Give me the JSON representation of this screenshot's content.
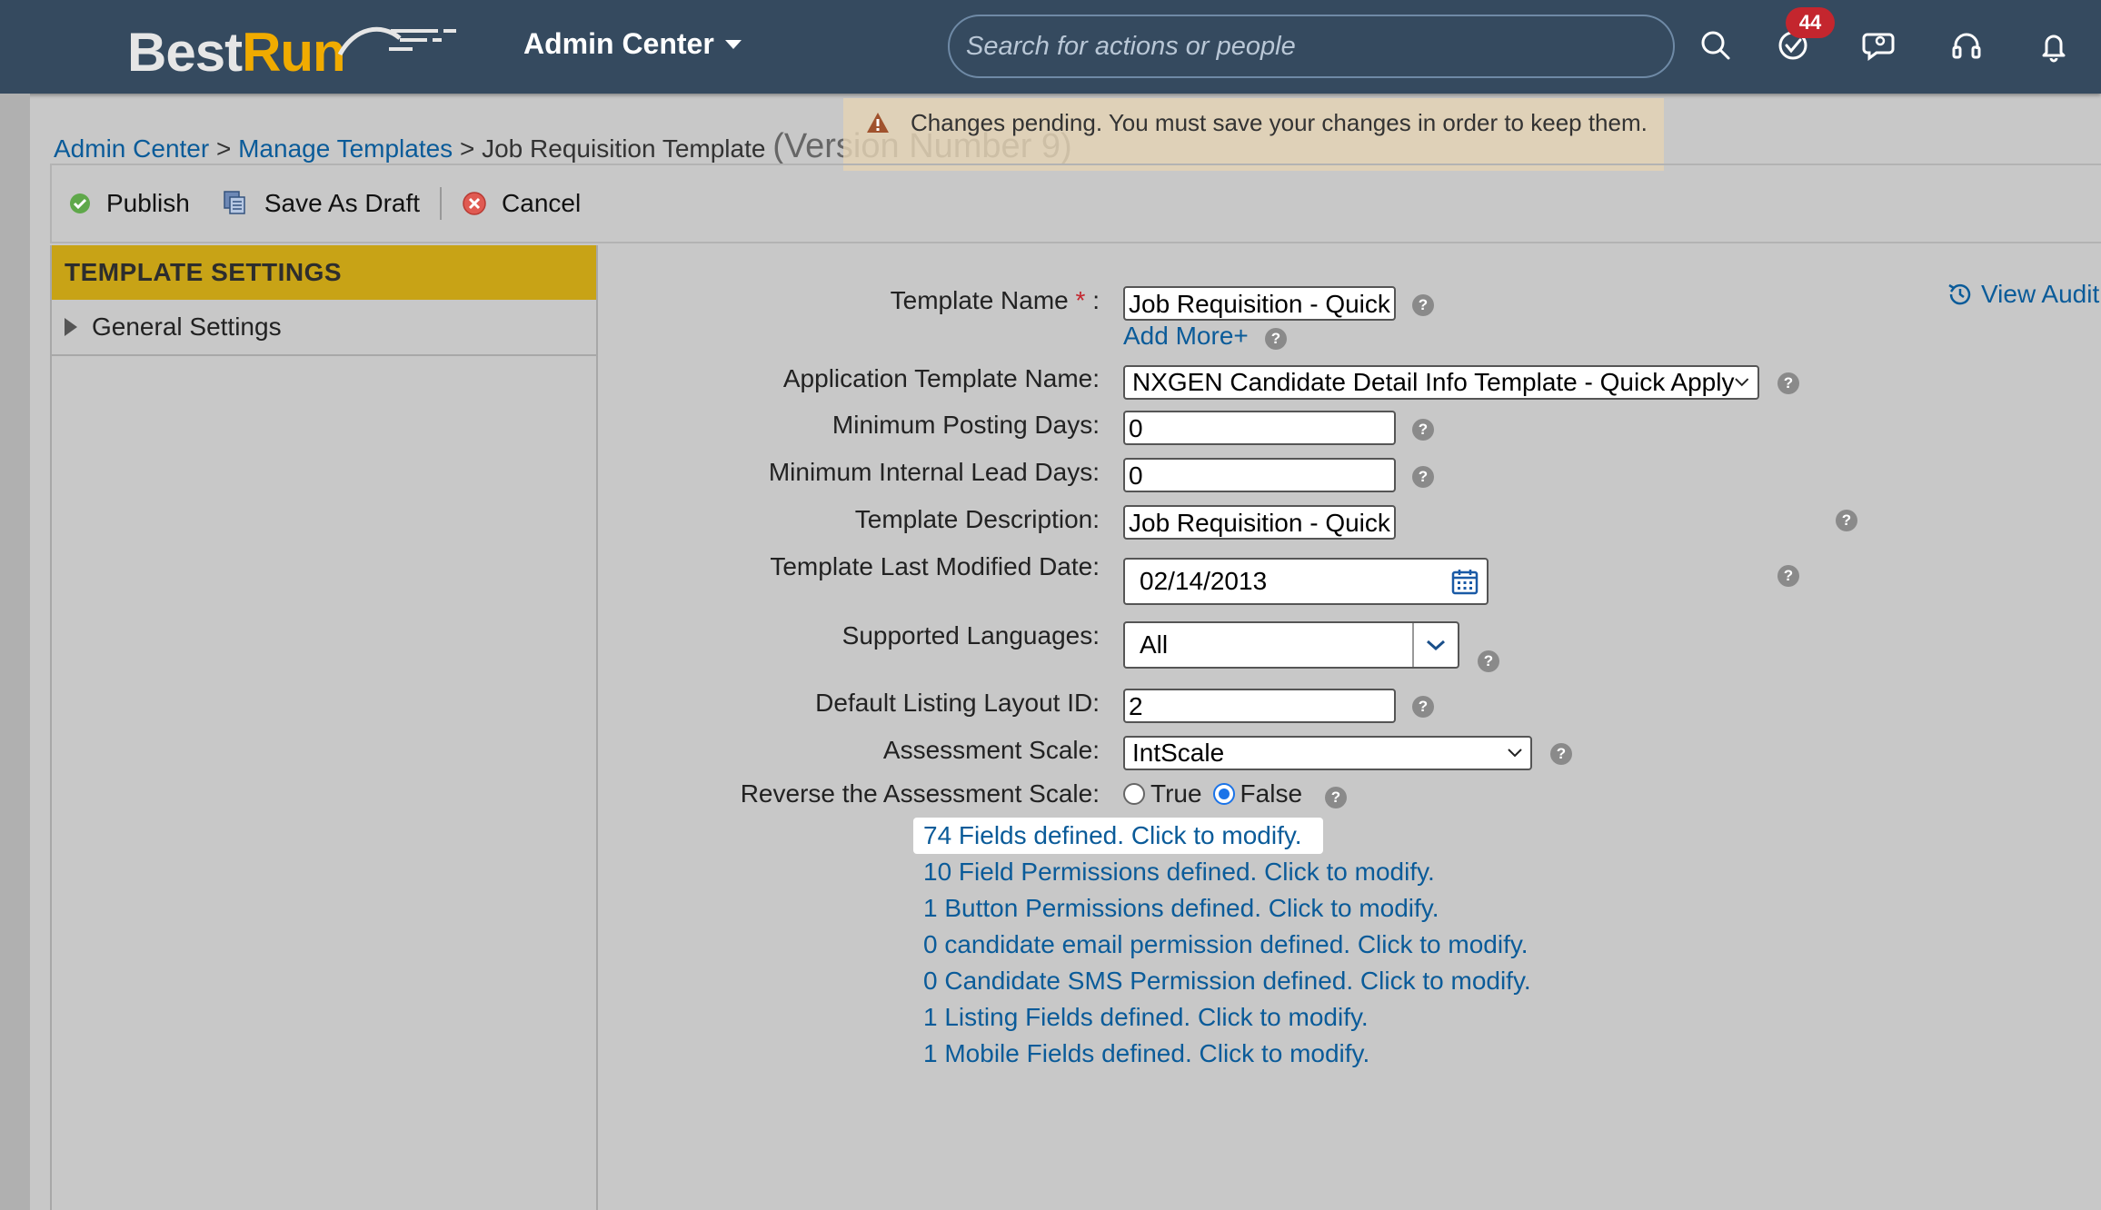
{
  "header": {
    "logo_best": "Best",
    "logo_run": "Run",
    "module_menu_label": "Admin Center",
    "search_placeholder": "Search for actions or people",
    "todo_badge": "44",
    "icons": [
      "search-icon",
      "todo-check-icon",
      "chat-icon",
      "headset-icon",
      "bell-icon"
    ]
  },
  "toast": {
    "message": "Changes pending. You must save your changes in order to keep them.",
    "icon": "warning-icon",
    "color": "#a0522d"
  },
  "breadcrumb": {
    "admin_center": "Admin Center",
    "sep1": ">",
    "manage_templates": "Manage Templates",
    "sep2": ">",
    "current": "Job Requisition Template",
    "version": "(Version Number 9)"
  },
  "toolbar": {
    "publish": "Publish",
    "save_as_draft": "Save As Draft",
    "cancel": "Cancel"
  },
  "left_panel": {
    "header": "TEMPLATE SETTINGS",
    "items": [
      {
        "label": "General Settings"
      }
    ]
  },
  "form": {
    "template_name_label": "Template Name",
    "template_name_required": "*",
    "template_name_colon": ":",
    "template_name_value": "Job Requisition - Quick",
    "add_more": "Add More+",
    "view_audit": "View Audit",
    "app_template_label": "Application Template Name:",
    "app_template_value": "NXGEN Candidate Detail Info Template - Quick Apply",
    "min_posting_label": "Minimum Posting Days:",
    "min_posting_value": "0",
    "min_internal_label": "Minimum Internal Lead Days:",
    "min_internal_value": "0",
    "description_label": "Template Description:",
    "description_value": "Job Requisition - Quick",
    "last_modified_label": "Template Last Modified Date:",
    "last_modified_value": "02/14/2013",
    "languages_label": "Supported Languages:",
    "languages_value": "All",
    "layout_id_label": "Default Listing Layout ID:",
    "layout_id_value": "2",
    "assessment_label": "Assessment Scale:",
    "assessment_value": "IntScale",
    "reverse_label": "Reverse the Assessment Scale:",
    "reverse_true": "True",
    "reverse_false": "False",
    "reverse_selected": "False"
  },
  "definition_links": [
    "74 Fields defined. Click to modify.",
    "10 Field Permissions defined. Click to modify.",
    "1 Button Permissions defined. Click to modify.",
    "0 candidate email permission defined. Click to modify.",
    "0 Candidate SMS Permission defined. Click to modify.",
    "1 Listing Fields defined. Click to modify.",
    "1 Mobile Fields defined. Click to modify."
  ],
  "colors": {
    "header_bg": "#354a5f",
    "accent_gold": "#c8a316",
    "link": "#0a5b99",
    "badge": "#c4262e"
  }
}
